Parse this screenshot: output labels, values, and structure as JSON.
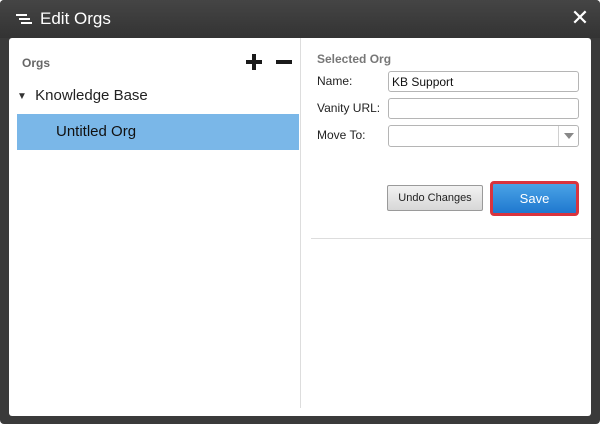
{
  "window": {
    "title": "Edit Orgs",
    "close_symbol": "✕"
  },
  "tree": {
    "header": "Orgs",
    "root": {
      "label": "Knowledge Base",
      "expanded": true
    },
    "children": [
      {
        "label": "Untitled Org",
        "selected": true
      }
    ]
  },
  "form": {
    "section_title": "Selected Org",
    "name_label": "Name:",
    "name_value": "KB Support",
    "vanity_label": "Vanity URL:",
    "vanity_value": "",
    "move_label": "Move To:",
    "move_value": ""
  },
  "buttons": {
    "undo_label": "Undo Changes",
    "save_label": "Save"
  },
  "icons": {
    "menu": "menu-lines-icon",
    "add": "plus-icon",
    "remove": "minus-icon",
    "expand": "caret-down-icon",
    "dropdown": "chevron-down-icon"
  },
  "colors": {
    "selection": "#7ab7e8",
    "save": "#2a88db",
    "save_highlight": "#d9343e",
    "titlebar": "#3a3a3a"
  }
}
